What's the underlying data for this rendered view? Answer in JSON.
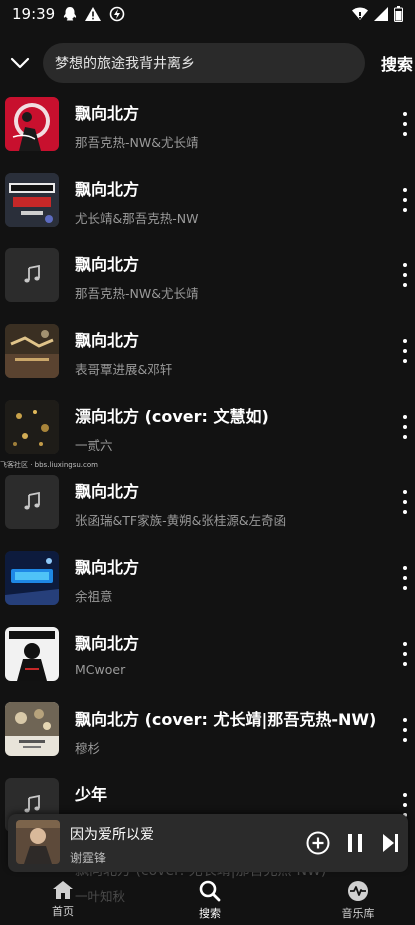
{
  "status_bar": {
    "time": "19:39"
  },
  "search": {
    "query": "梦想的旅途我背井离乡",
    "button_label": "搜索"
  },
  "watermark": "飞客社区 · bbs.liuxingsu.com",
  "songs": [
    {
      "title": "飘向北方",
      "artist": "那吾克热-NW&尤长靖",
      "cover": "red-singer"
    },
    {
      "title": "飘向北方",
      "artist": "尤长靖&那吾克热-NW",
      "cover": "rap-china"
    },
    {
      "title": "飘向北方",
      "artist": "那吾克热-NW&尤长靖",
      "cover": "music-note"
    },
    {
      "title": "飘向北方",
      "artist": "表哥覃进展&邓轩",
      "cover": "golden-text"
    },
    {
      "title": "漂向北方 (cover: 文慧如)",
      "artist": "一贰六",
      "cover": "dark-gold"
    },
    {
      "title": "飘向北方",
      "artist": "张函瑞&TF家族-黄朔&张桂源&左奇函",
      "cover": "music-note"
    },
    {
      "title": "飘向北方",
      "artist": "余祖意",
      "cover": "blue-stage"
    },
    {
      "title": "飘向北方",
      "artist": "MCwoer",
      "cover": "black-white"
    },
    {
      "title": "飘向北方 (cover: 尤长靖|那吾克热-NW)",
      "artist": "穆杉",
      "cover": "flower-collection"
    },
    {
      "title": "少年",
      "artist": "",
      "cover": "music-note"
    }
  ],
  "ghost_row": {
    "title": "飘向北方 (cover: 尤长靖|那吾克热-NW)",
    "artist": "一叶知秋"
  },
  "mini_player": {
    "title": "因为爱所以爱",
    "artist": "谢霆锋"
  },
  "nav": {
    "home": "首页",
    "search": "搜索",
    "library": "音乐库"
  },
  "colors": {
    "background": "#121212",
    "search_box": "#2a2a2a",
    "secondary_text": "#9a9a9a",
    "player_bg": "#2b2b2b"
  }
}
